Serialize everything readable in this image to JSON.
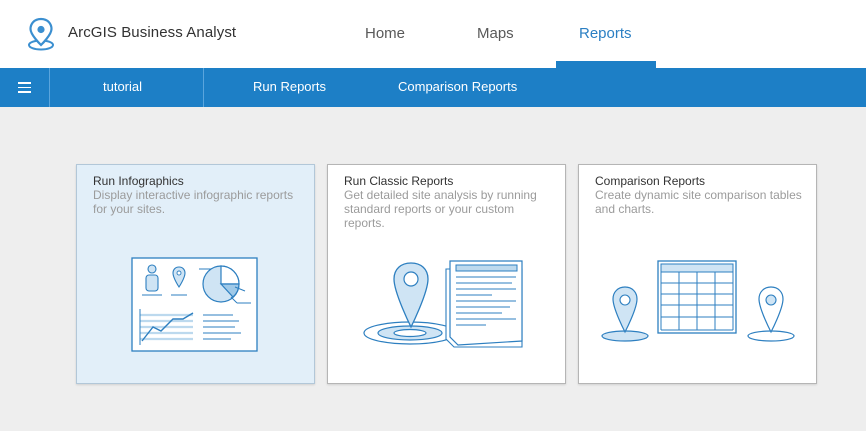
{
  "header": {
    "app_title": "ArcGIS Business Analyst",
    "logo_icon": "location-pin-icon",
    "tabs": [
      {
        "label": "Home",
        "active": false
      },
      {
        "label": "Maps",
        "active": false
      },
      {
        "label": "Reports",
        "active": true
      }
    ]
  },
  "subnav": {
    "menu_icon": "hamburger-menu-icon",
    "items": [
      {
        "label": "tutorial"
      },
      {
        "label": "Run Reports"
      },
      {
        "label": "Comparison Reports"
      }
    ]
  },
  "cards": [
    {
      "title": "Run Infographics",
      "description": "Display interactive infographic reports for your sites.",
      "icon": "infographic-illustration",
      "selected": true
    },
    {
      "title": "Run Classic Reports",
      "description": "Get detailed site analysis by running standard reports or your custom reports.",
      "icon": "classic-report-illustration",
      "selected": false
    },
    {
      "title": "Comparison Reports",
      "description": "Create dynamic site comparison tables and charts.",
      "icon": "comparison-table-illustration",
      "selected": false
    }
  ],
  "colors": {
    "accent": "#1d7fc6",
    "active_tab_text": "#2b7fc3",
    "selected_card": "#e2eff9",
    "background": "#eeeeee"
  }
}
